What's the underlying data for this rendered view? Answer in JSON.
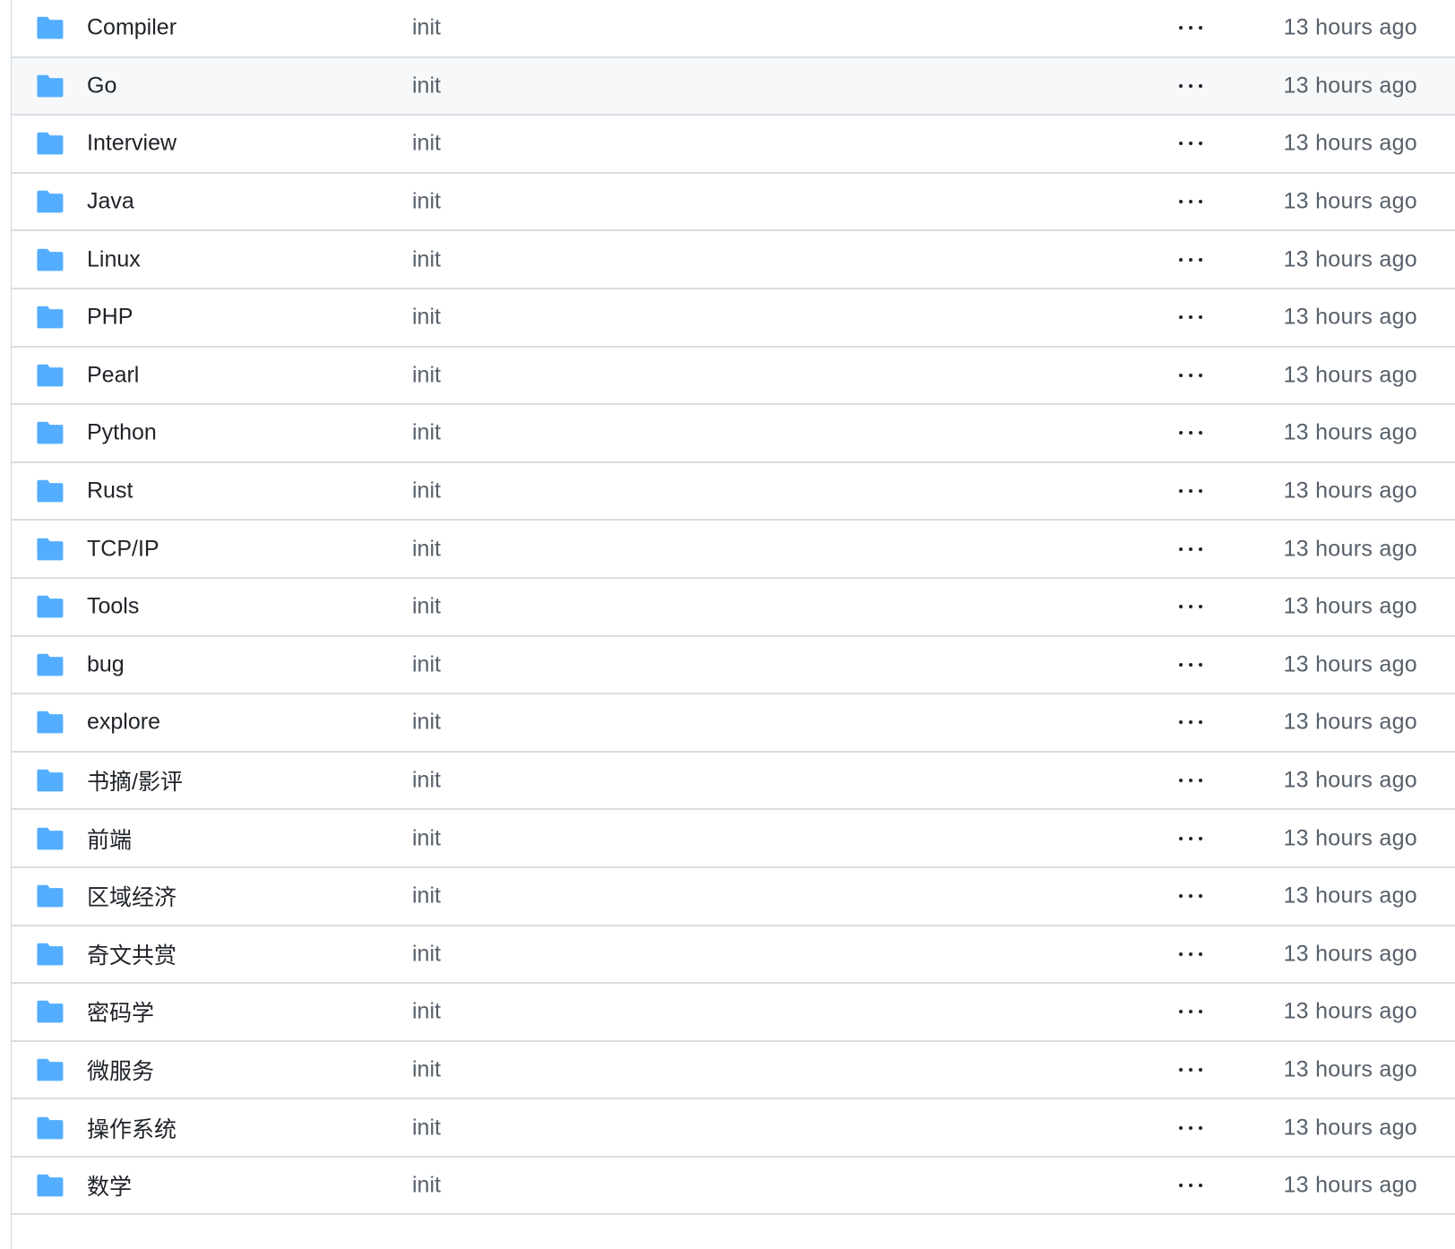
{
  "colors": {
    "folder_icon": "#54aeff",
    "text_primary": "#1f2328",
    "text_muted": "#57606a",
    "border": "#d8dee4",
    "row_hover": "#f6f8fa"
  },
  "file_list": {
    "icon": "folder-icon",
    "more_icon": "ellipsis-icon",
    "hovered_row": 1,
    "rows": [
      {
        "name": "Compiler",
        "commit": "init",
        "age": "13 hours ago"
      },
      {
        "name": "Go",
        "commit": "init",
        "age": "13 hours ago"
      },
      {
        "name": "Interview",
        "commit": "init",
        "age": "13 hours ago"
      },
      {
        "name": "Java",
        "commit": "init",
        "age": "13 hours ago"
      },
      {
        "name": "Linux",
        "commit": "init",
        "age": "13 hours ago"
      },
      {
        "name": "PHP",
        "commit": "init",
        "age": "13 hours ago"
      },
      {
        "name": "Pearl",
        "commit": "init",
        "age": "13 hours ago"
      },
      {
        "name": "Python",
        "commit": "init",
        "age": "13 hours ago"
      },
      {
        "name": "Rust",
        "commit": "init",
        "age": "13 hours ago"
      },
      {
        "name": "TCP/IP",
        "commit": "init",
        "age": "13 hours ago"
      },
      {
        "name": "Tools",
        "commit": "init",
        "age": "13 hours ago"
      },
      {
        "name": "bug",
        "commit": "init",
        "age": "13 hours ago"
      },
      {
        "name": "explore",
        "commit": "init",
        "age": "13 hours ago"
      },
      {
        "name": "书摘/影评",
        "commit": "init",
        "age": "13 hours ago"
      },
      {
        "name": "前端",
        "commit": "init",
        "age": "13 hours ago"
      },
      {
        "name": "区域经济",
        "commit": "init",
        "age": "13 hours ago"
      },
      {
        "name": "奇文共赏",
        "commit": "init",
        "age": "13 hours ago"
      },
      {
        "name": "密码学",
        "commit": "init",
        "age": "13 hours ago"
      },
      {
        "name": "微服务",
        "commit": "init",
        "age": "13 hours ago"
      },
      {
        "name": "操作系统",
        "commit": "init",
        "age": "13 hours ago"
      },
      {
        "name": "数学",
        "commit": "init",
        "age": "13 hours ago"
      }
    ]
  }
}
